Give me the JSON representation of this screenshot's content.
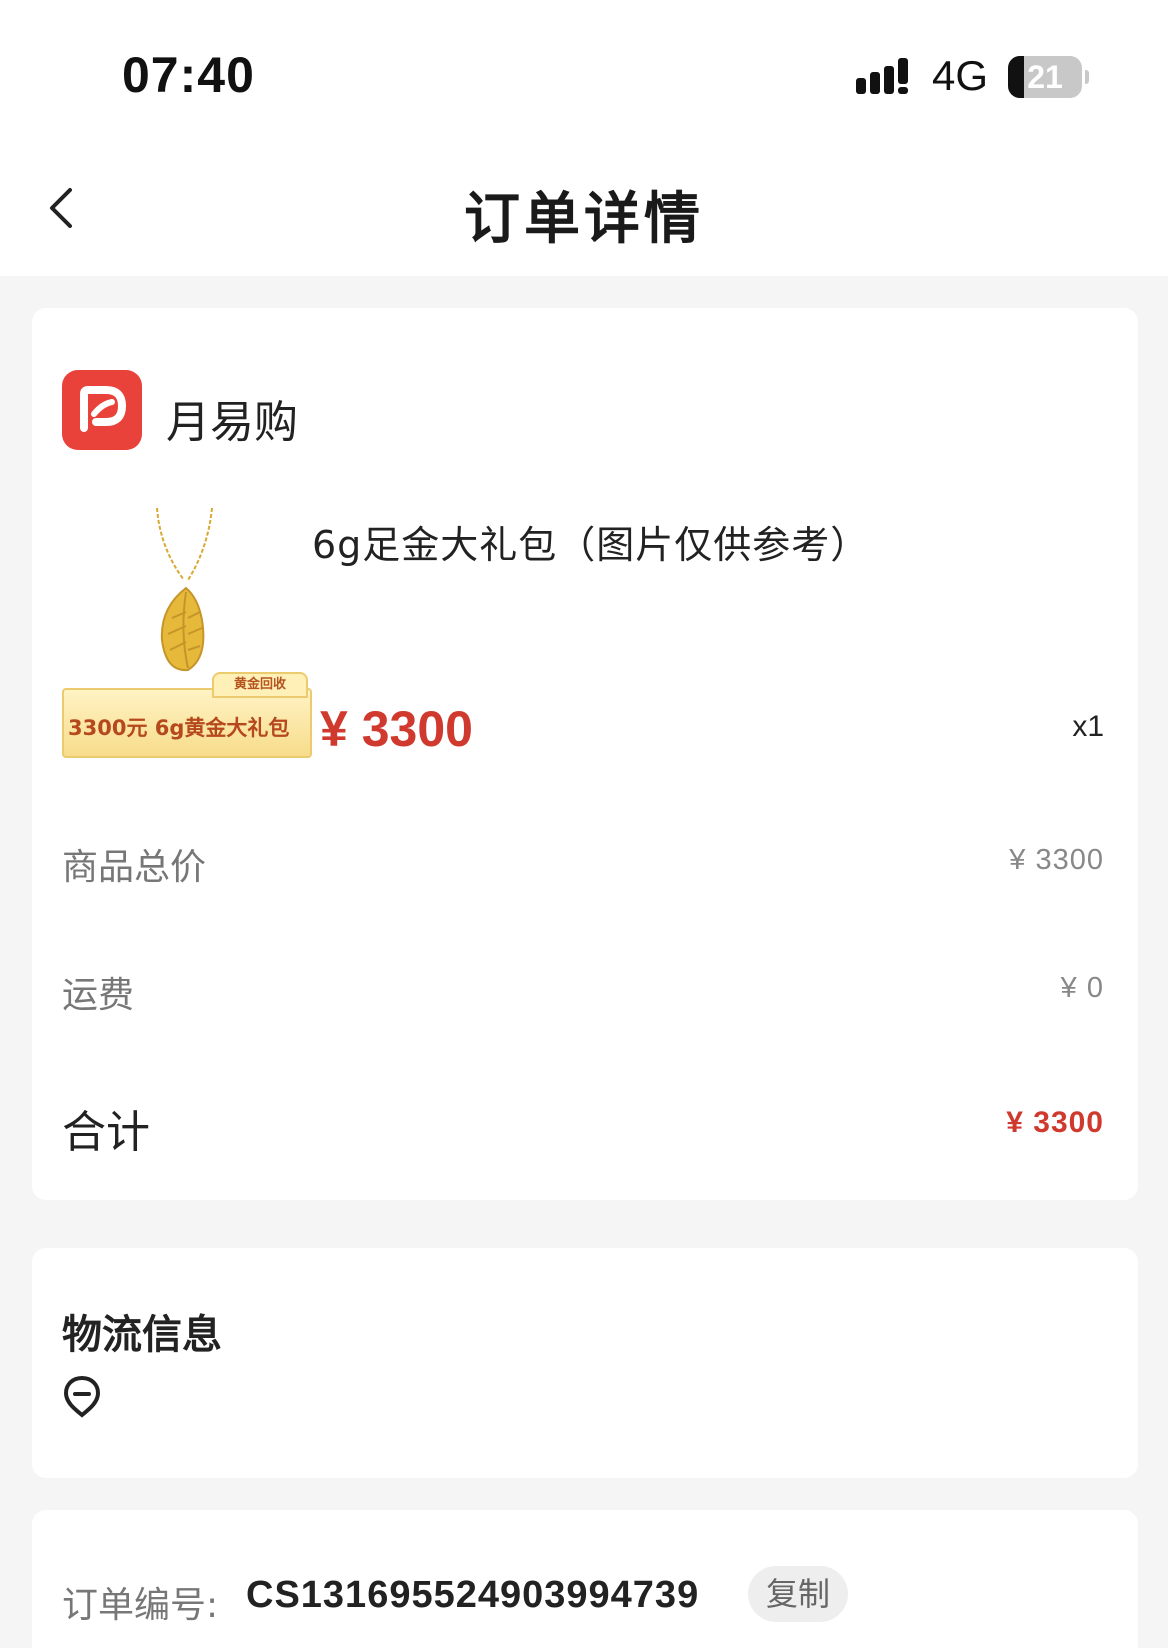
{
  "status_bar": {
    "time": "07:40",
    "network": "4G",
    "battery_level": "21",
    "battery_fraction": 0.21,
    "signal_icon": "signal-bars-icon",
    "battery_icon": "battery-icon"
  },
  "nav": {
    "title": "订单详情",
    "back_icon": "chevron-left-icon"
  },
  "shop": {
    "name": "月易购",
    "logo_color": "#e8423a",
    "logo_icon": "shop-logo-icon"
  },
  "product": {
    "name": "6g足金大礼包（图片仅供参考）",
    "banner_tag": "黄金回收",
    "banner_text": "3300元  6g黄金大礼包",
    "price": "¥ 3300",
    "quantity": "x1",
    "image_icon": "gold-feather-necklace-image"
  },
  "summary": {
    "goods_total_label": "商品总价",
    "goods_total_value": "¥ 3300",
    "shipping_label": "运费",
    "shipping_value": "¥ 0",
    "total_label": "合计",
    "total_value": "¥ 3300"
  },
  "logistics": {
    "title": "物流信息",
    "location_icon": "location-pin-icon"
  },
  "order_info": {
    "order_no_label": "订单编号:",
    "order_no_value": "CS1316955249039947 39",
    "copy_label": "复制"
  },
  "colors": {
    "accent_red": "#d0392e",
    "background": "#f5f5f5",
    "card": "#ffffff"
  }
}
